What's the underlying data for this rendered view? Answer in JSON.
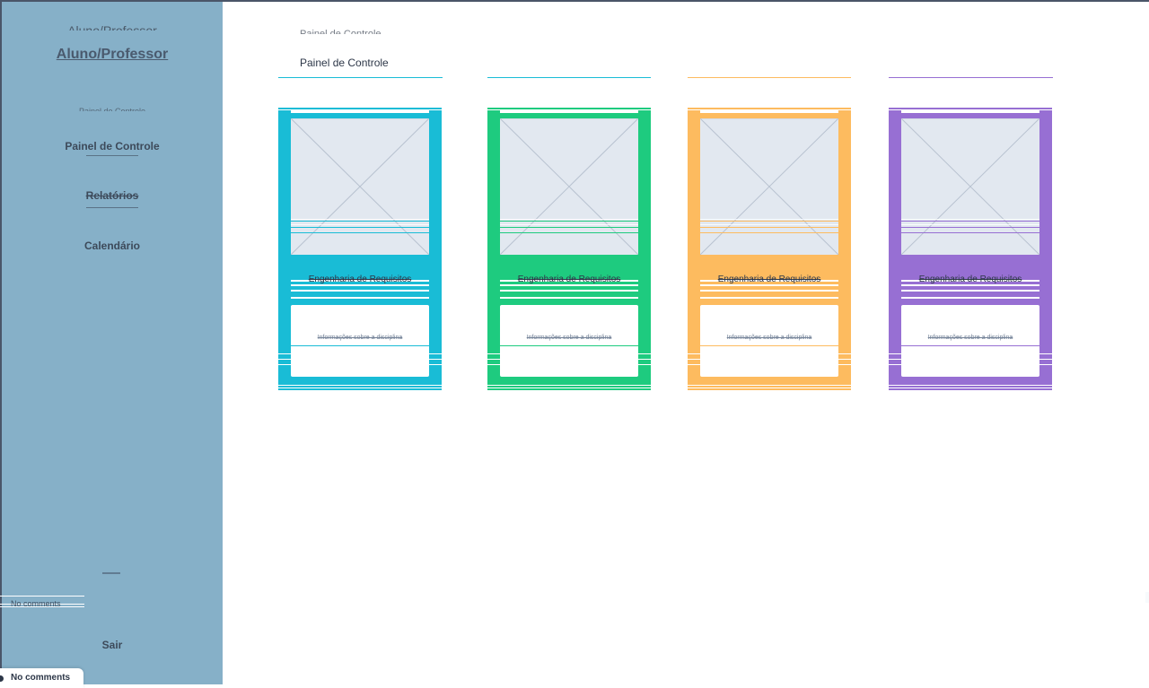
{
  "sidebar": {
    "title_ghost": "Aluno/Professor",
    "title": "Aluno/Professor",
    "nav_ghost": "Painel de Controle",
    "items": [
      {
        "label": "Painel de Controle"
      },
      {
        "label": "Relatórios"
      },
      {
        "label": "Calendário"
      }
    ],
    "exit_label": "Sair",
    "ghost_comment": "No comments"
  },
  "comments": {
    "label": "No comments"
  },
  "main": {
    "title_ghost": "Painel de Controle",
    "title": "Painel de Controle"
  },
  "cards": [
    {
      "name": "Engenharia de Requisitos",
      "info": "Informações sobre a disciplina",
      "color": "#19bcd6"
    },
    {
      "name": "Engenharia de Requisitos",
      "info": "Informações sobre a disciplina",
      "color": "#1ecb7f"
    },
    {
      "name": "Engenharia de Requisitos",
      "info": "Informações sobre a disciplina",
      "color": "#fdbb5f"
    },
    {
      "name": "Engenharia de Requisitos",
      "info": "Informações sobre a disciplina",
      "color": "#976fd3"
    }
  ],
  "colors": {
    "sidebar_bg": "#86b0c8",
    "text_dark": "#2d3748"
  }
}
